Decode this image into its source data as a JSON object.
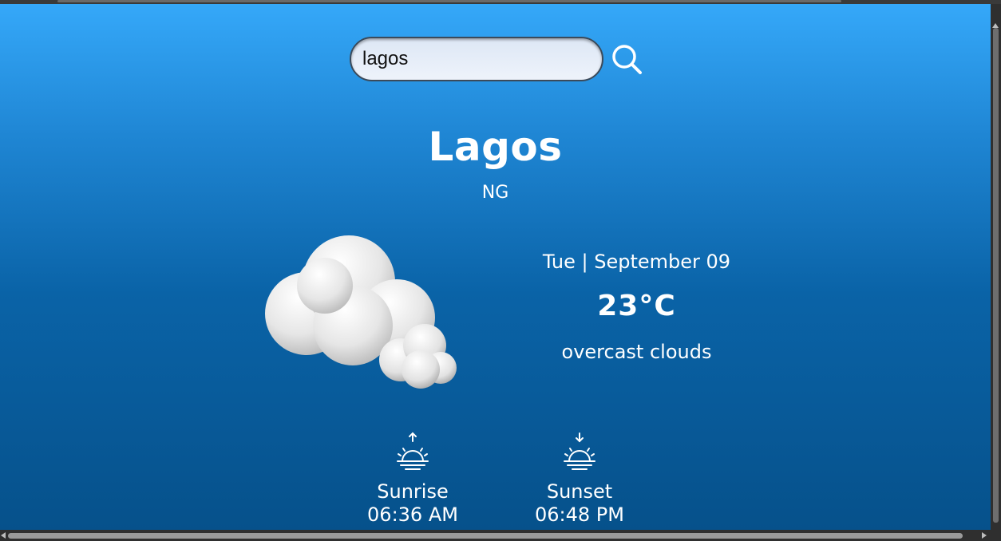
{
  "search": {
    "value": "lagos",
    "icon": "search-icon"
  },
  "location": {
    "city": "Lagos",
    "country": "NG"
  },
  "weather": {
    "date": "Tue | September 09",
    "temperature": "23°C",
    "description": "overcast clouds",
    "icon": "cloud-icon"
  },
  "sun": {
    "sunrise": {
      "label": "Sunrise",
      "time": "06:36 AM",
      "icon": "sunrise-icon"
    },
    "sunset": {
      "label": "Sunset",
      "time": "06:48 PM",
      "icon": "sunset-icon"
    }
  },
  "colors": {
    "bg_top": "#35a8f9",
    "bg_bottom": "#06518b",
    "text": "#ffffff"
  }
}
